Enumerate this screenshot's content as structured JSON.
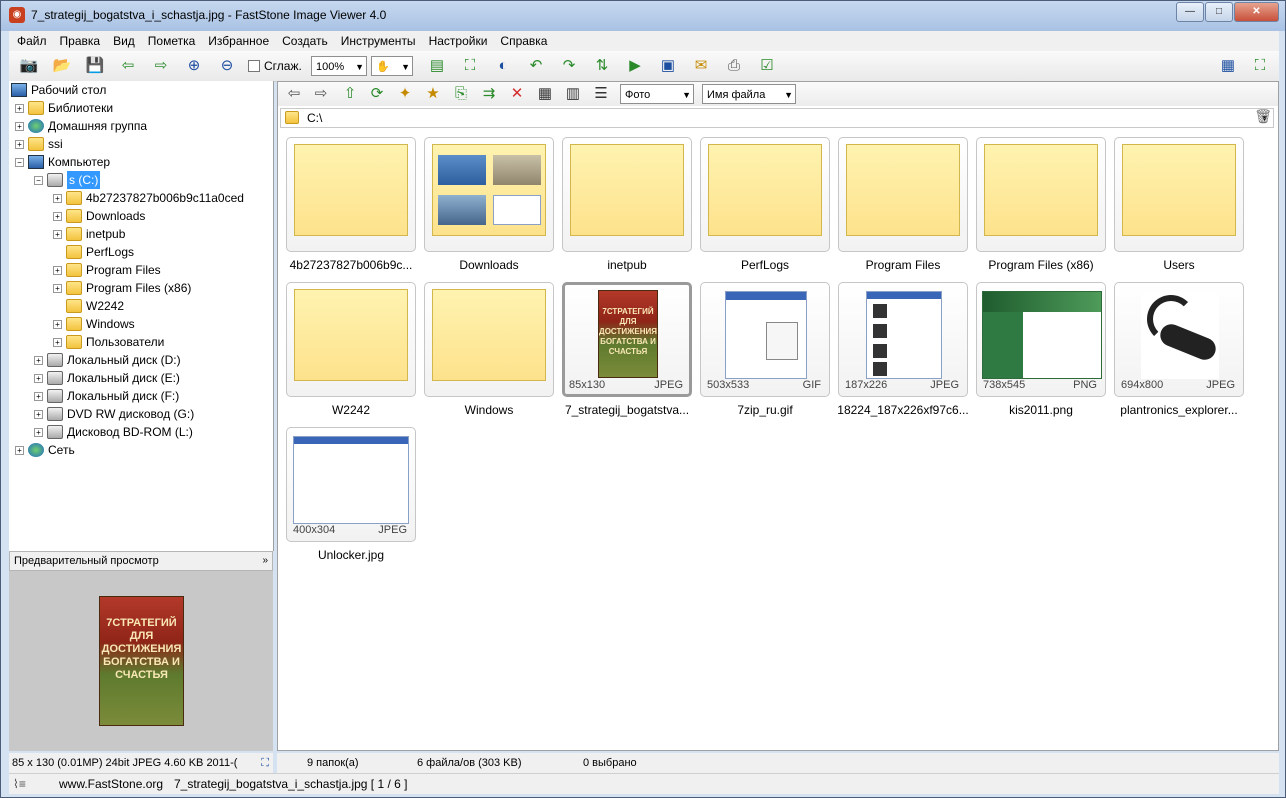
{
  "window": {
    "title": "7_strategij_bogatstva_i_schastja.jpg  -  FastStone Image Viewer 4.0",
    "minimize": "—",
    "maximize": "□",
    "close": "✕"
  },
  "menu": [
    "Файл",
    "Правка",
    "Вид",
    "Пометка",
    "Избранное",
    "Создать",
    "Инструменты",
    "Настройки",
    "Справка"
  ],
  "toolbar": {
    "smooth_label": "Сглаж.",
    "zoom_value": "100%"
  },
  "nav": {
    "filter_value": "Фото",
    "sort_value": "Имя файла",
    "path": "C:\\"
  },
  "tree": {
    "desktop": "Рабочий стол",
    "libraries": "Библиотеки",
    "homegroup": "Домашняя группа",
    "ssi": "ssi",
    "computer": "Компьютер",
    "drive_c": "s (C:)",
    "folders": [
      "4b27237827b006b9c11a0ced",
      "Downloads",
      "inetpub",
      "PerfLogs",
      "Program Files",
      "Program Files (x86)",
      "W2242",
      "Windows",
      "Пользователи"
    ],
    "drive_d": "Локальный диск (D:)",
    "drive_e": "Локальный диск (E:)",
    "drive_f": "Локальный диск (F:)",
    "drive_g": "DVD RW дисковод (G:)",
    "drive_l": "Дисковод BD-ROM (L:)",
    "network": "Сеть"
  },
  "preview": {
    "title": "Предварительный просмотр",
    "book_title": "7СТРАТЕГИЙ ДЛЯ ДОСТИЖЕНИЯ БОГАТСТВА И СЧАСТЬЯ"
  },
  "thumbs": {
    "folders": [
      "4b27237827b006b9c...",
      "Downloads",
      "inetpub",
      "PerfLogs",
      "Program Files",
      "Program Files (x86)",
      "Users",
      "W2242",
      "Windows"
    ],
    "files": [
      {
        "name": "7_strategij_bogatstva...",
        "dims": "85x130",
        "type": "JPEG"
      },
      {
        "name": "7zip_ru.gif",
        "dims": "503x533",
        "type": "GIF"
      },
      {
        "name": "18224_187x226xf97c6...",
        "dims": "187x226",
        "type": "JPEG"
      },
      {
        "name": "kis2011.png",
        "dims": "738x545",
        "type": "PNG"
      },
      {
        "name": "plantronics_explorer...",
        "dims": "694x800",
        "type": "JPEG"
      },
      {
        "name": "Unlocker.jpg",
        "dims": "400x304",
        "type": "JPEG"
      }
    ]
  },
  "status": {
    "left_info": "85 x 130 (0.01MP)   24bit JPEG   4.60 KB   2011-(",
    "folders": "9 папок(а)",
    "files": "6 файла/ов (303 KB)",
    "selected": "0 выбрано",
    "site": "www.FastStone.org",
    "current_file": "7_strategij_bogatstva_i_schastja.jpg [ 1 / 6 ]"
  }
}
